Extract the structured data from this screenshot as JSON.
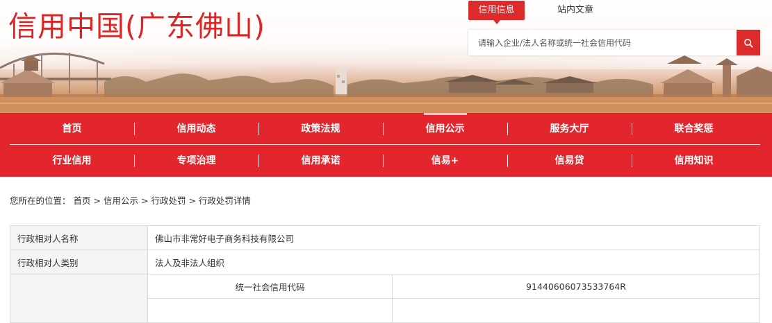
{
  "site": {
    "title": "信用中国(广东佛山)"
  },
  "header_tabs": {
    "credit_info": "信用信息",
    "site_articles": "站内文章"
  },
  "search": {
    "placeholder": "请输入企业/法人名称或统一社会信用代码",
    "icon": "search-icon"
  },
  "nav": {
    "row1": [
      {
        "label": "首页"
      },
      {
        "label": "信用动态"
      },
      {
        "label": "政策法规"
      },
      {
        "label": "信用公示",
        "active": true
      },
      {
        "label": "服务大厅"
      },
      {
        "label": "联合奖惩"
      }
    ],
    "row2": [
      {
        "label": "行业信用"
      },
      {
        "label": "专项治理"
      },
      {
        "label": "信用承诺"
      },
      {
        "label": "信易+"
      },
      {
        "label": "信易贷"
      },
      {
        "label": "信用知识"
      }
    ]
  },
  "breadcrumb": {
    "prefix": "您所在的位置：",
    "items": [
      "首页",
      "信用公示",
      "行政处罚",
      "行政处罚详情"
    ],
    "separator": ">"
  },
  "detail": {
    "name_label": "行政相对人名称",
    "name_value": "佛山市非常好电子商务科技有限公司",
    "type_label": "行政相对人类别",
    "type_value": "法人及非法人组织",
    "code_label": "统一社会信用代码",
    "code_value": "91440606073533764R"
  },
  "colors": {
    "brand_red": "#e3262d",
    "title_red": "#de2525"
  }
}
